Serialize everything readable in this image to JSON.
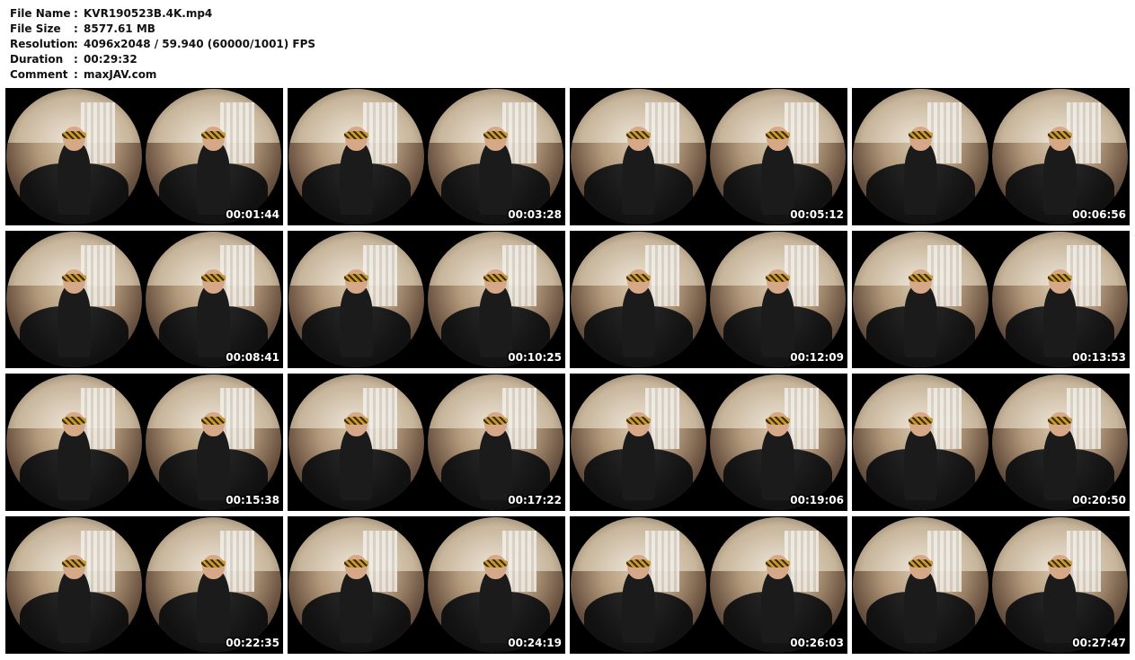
{
  "info": {
    "rows": [
      {
        "label": "File Name",
        "sep": ":",
        "value": "KVR190523B.4K.mp4"
      },
      {
        "label": "File Size",
        "sep": ":",
        "value": "8577.61 MB"
      },
      {
        "label": "Resolution",
        "sep": ":",
        "value": "4096x2048 / 59.940 (60000/1001) FPS"
      },
      {
        "label": "Duration",
        "sep": ":",
        "value": "00:29:32"
      },
      {
        "label": "Comment",
        "sep": ":",
        "value": "maxJAV.com"
      }
    ]
  },
  "thumbnails": [
    {
      "timestamp": "00:01:44"
    },
    {
      "timestamp": "00:03:28"
    },
    {
      "timestamp": "00:05:12"
    },
    {
      "timestamp": "00:06:56"
    },
    {
      "timestamp": "00:08:41"
    },
    {
      "timestamp": "00:10:25"
    },
    {
      "timestamp": "00:12:09"
    },
    {
      "timestamp": "00:13:53"
    },
    {
      "timestamp": "00:15:38"
    },
    {
      "timestamp": "00:17:22"
    },
    {
      "timestamp": "00:19:06"
    },
    {
      "timestamp": "00:20:50"
    },
    {
      "timestamp": "00:22:35"
    },
    {
      "timestamp": "00:24:19"
    },
    {
      "timestamp": "00:26:03"
    },
    {
      "timestamp": "00:27:47"
    }
  ]
}
